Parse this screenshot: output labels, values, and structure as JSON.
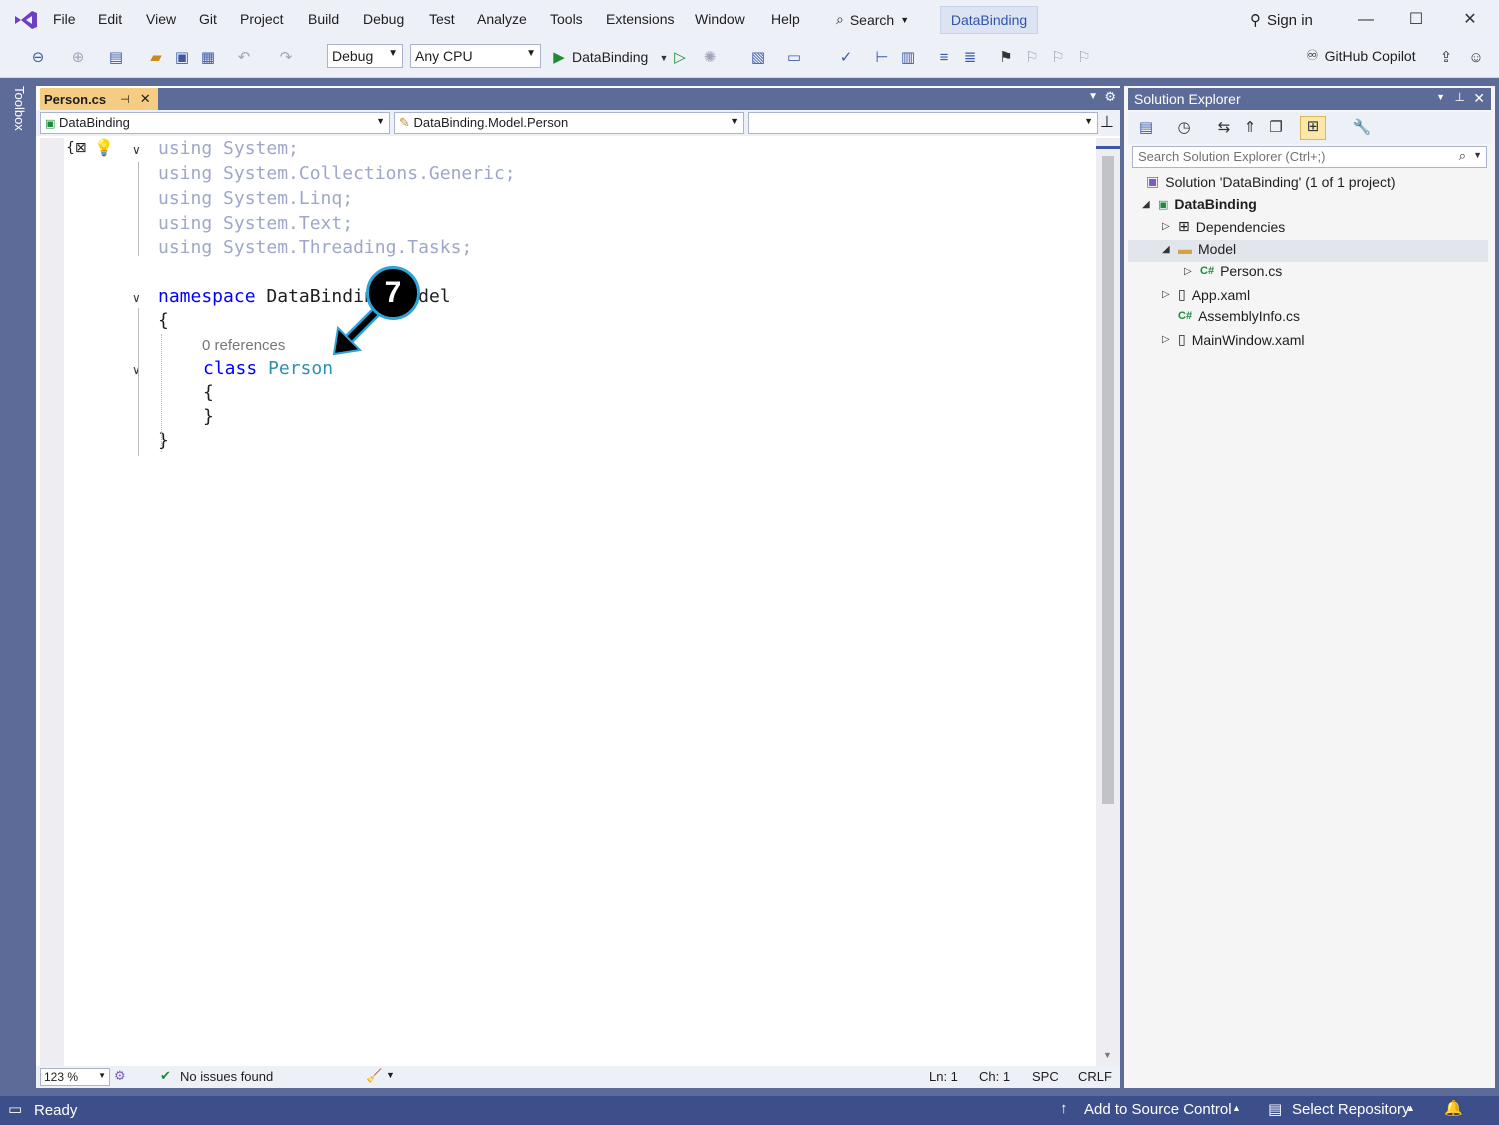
{
  "menu": {
    "items": [
      "File",
      "Edit",
      "View",
      "Git",
      "Project",
      "Build",
      "Debug",
      "Test",
      "Analyze",
      "Tools",
      "Extensions",
      "Window",
      "Help"
    ],
    "search_label": "Search",
    "solution_name": "DataBinding",
    "sign_in": "Sign in"
  },
  "toolbar": {
    "config": "Debug",
    "platform": "Any CPU",
    "run_target": "DataBinding",
    "copilot": "GitHub Copilot"
  },
  "toolbox_label": "Toolbox",
  "editor": {
    "tab_title": "Person.cs",
    "nav_project": "DataBinding",
    "nav_type": "DataBinding.Model.Person",
    "nav_member": "",
    "lines": {
      "u1": "using System;",
      "u2": "using System.Collections.Generic;",
      "u3": "using System.Linq;",
      "u4": "using System.Text;",
      "u5": "using System.Threading.Tasks;",
      "ns_kw": "namespace",
      "ns_name": "DataBinding.Model",
      "open_brace": "{",
      "refs": "0 references",
      "class_kw": "class",
      "class_name": "Person",
      "inner_open": "{",
      "inner_close": "}",
      "close_brace": "}"
    },
    "status": {
      "zoom": "123 %",
      "issues": "No issues found",
      "ln": "Ln: 1",
      "ch": "Ch: 1",
      "spc": "SPC",
      "crlf": "CRLF"
    }
  },
  "solution_explorer": {
    "title": "Solution Explorer",
    "search_placeholder": "Search Solution Explorer (Ctrl+;)",
    "solution": "Solution 'DataBinding' (1 of 1 project)",
    "project": "DataBinding",
    "items": {
      "dependencies": "Dependencies",
      "model": "Model",
      "person": "Person.cs",
      "app": "App.xaml",
      "assembly": "AssemblyInfo.cs",
      "mainwindow": "MainWindow.xaml"
    },
    "cs_badge": "C#"
  },
  "statusbar": {
    "ready": "Ready",
    "source_control": "Add to Source Control",
    "repository": "Select Repository"
  },
  "callout": {
    "number": "7"
  },
  "colors": {
    "chrome": "#5d6b99",
    "tab_active": "#f5cc84",
    "keyword": "#0000ff",
    "type": "#2b91af",
    "status_bar": "#3c4f8b",
    "callout_ring": "#2ea3d8"
  }
}
